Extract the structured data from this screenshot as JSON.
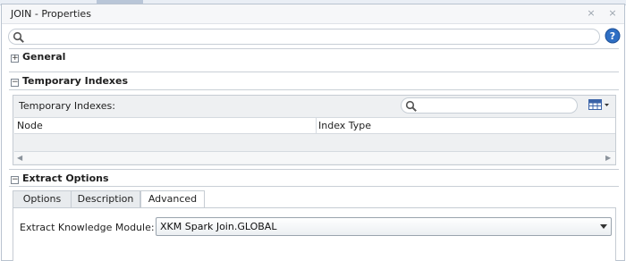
{
  "window": {
    "title": "JOIN - Properties",
    "minimize_glyph": "×",
    "close_glyph": "×"
  },
  "search": {
    "placeholder": "",
    "icon": "search-icon"
  },
  "help": {
    "icon": "help-icon",
    "glyph": "?"
  },
  "sections": {
    "general": {
      "label": "General",
      "expanded": false
    },
    "temporary_indexes": {
      "label": "Temporary Indexes",
      "expanded": true,
      "panel_label": "Temporary Indexes:",
      "columns": [
        "Node",
        "Index Type"
      ],
      "rows": []
    },
    "extract_options": {
      "label": "Extract Options",
      "expanded": true,
      "tabs": [
        {
          "label": "Options",
          "active": false
        },
        {
          "label": "Description",
          "active": false
        },
        {
          "label": "Advanced",
          "active": true
        }
      ],
      "ekm_label": "Extract Knowledge Module:",
      "ekm_value": "XKM Spark Join.GLOBAL"
    }
  },
  "colors": {
    "accent": "#2f6fc4",
    "border": "#c6ccd3",
    "panel_bg": "#eef0f2"
  }
}
